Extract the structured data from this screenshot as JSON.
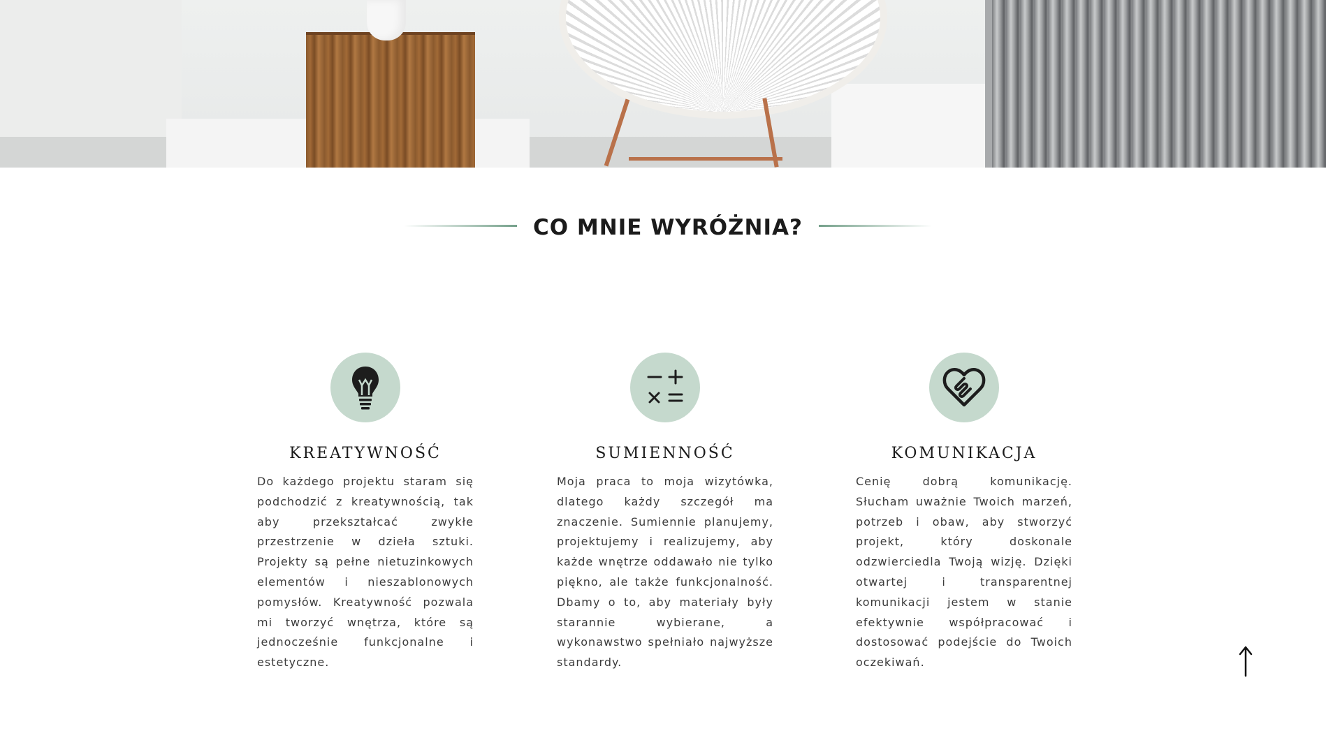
{
  "hero": {
    "image_alt": "Wnętrze z drewnianym stołkiem, białym krzesłem i grzejnikiem"
  },
  "section": {
    "title": "CO MNIE WYRÓŻNIA?",
    "accent_color": "#74a08a"
  },
  "features": [
    {
      "icon": "lightbulb-icon",
      "title": "KREATYWNOŚĆ",
      "text": "Do każdego projektu staram się podchodzić z kreatywnością, tak aby przekształcać zwykłe przestrzenie w dzieła sztuki. Projekty są pełne nietuzinkowych elementów i nieszablonowych pomysłów. Kreatywność pozwala mi tworzyć wnętrza, które są jednocześnie funkcjonalne i estetyczne."
    },
    {
      "icon": "calculator-icon",
      "title": "SUMIENNOŚĆ",
      "text": "Moja praca to moja wizytówka, dlatego każdy szczegół ma znaczenie. Sumiennie planujemy, projektujemy i realizujemy, aby każde wnętrze oddawało nie tylko piękno, ale także funkcjonalność. Dbamy o to, aby materiały były starannie wybierane, a wykonawstwo spełniało najwyższe standardy."
    },
    {
      "icon": "heart-handshake-icon",
      "title": "KOMUNIKACJA",
      "text": "Cenię dobrą komunikację. Słucham uważnie Twoich marzeń, potrzeb i obaw, aby stworzyć projekt, który doskonale odzwierciedla Twoją wizję. Dzięki otwartej i transparentnej komunikacji jestem w stanie efektywnie współpracować i dostosować podejście do Twoich oczekiwań."
    }
  ],
  "icon_circle_color": "#c5d9cd",
  "scroll_top": {
    "icon": "arrow-up-icon"
  }
}
